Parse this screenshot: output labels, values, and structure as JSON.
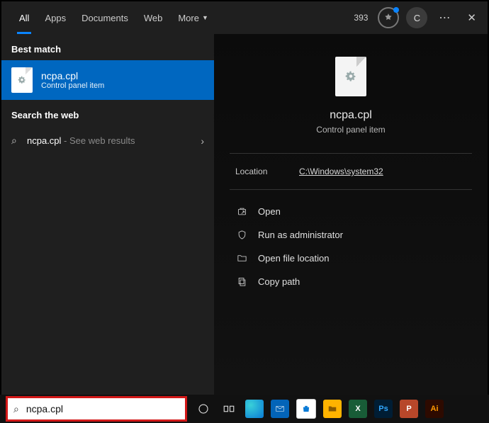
{
  "header": {
    "tabs": [
      "All",
      "Apps",
      "Documents",
      "Web",
      "More"
    ],
    "points": "393",
    "avatar_letter": "C"
  },
  "left": {
    "best_match_label": "Best match",
    "match": {
      "title": "ncpa.cpl",
      "subtitle": "Control panel item"
    },
    "search_web_label": "Search the web",
    "web": {
      "query": "ncpa.cpl",
      "suffix": " - See web results"
    }
  },
  "right": {
    "title": "ncpa.cpl",
    "subtitle": "Control panel item",
    "location_label": "Location",
    "location_value": "C:\\Windows\\system32",
    "actions": {
      "open": "Open",
      "admin": "Run as administrator",
      "openloc": "Open file location",
      "copy": "Copy path"
    }
  },
  "taskbar": {
    "search_value": "ncpa.cpl",
    "apps": {
      "excel": "X",
      "ps": "Ps",
      "ppt": "P",
      "ai": "Ai"
    }
  }
}
